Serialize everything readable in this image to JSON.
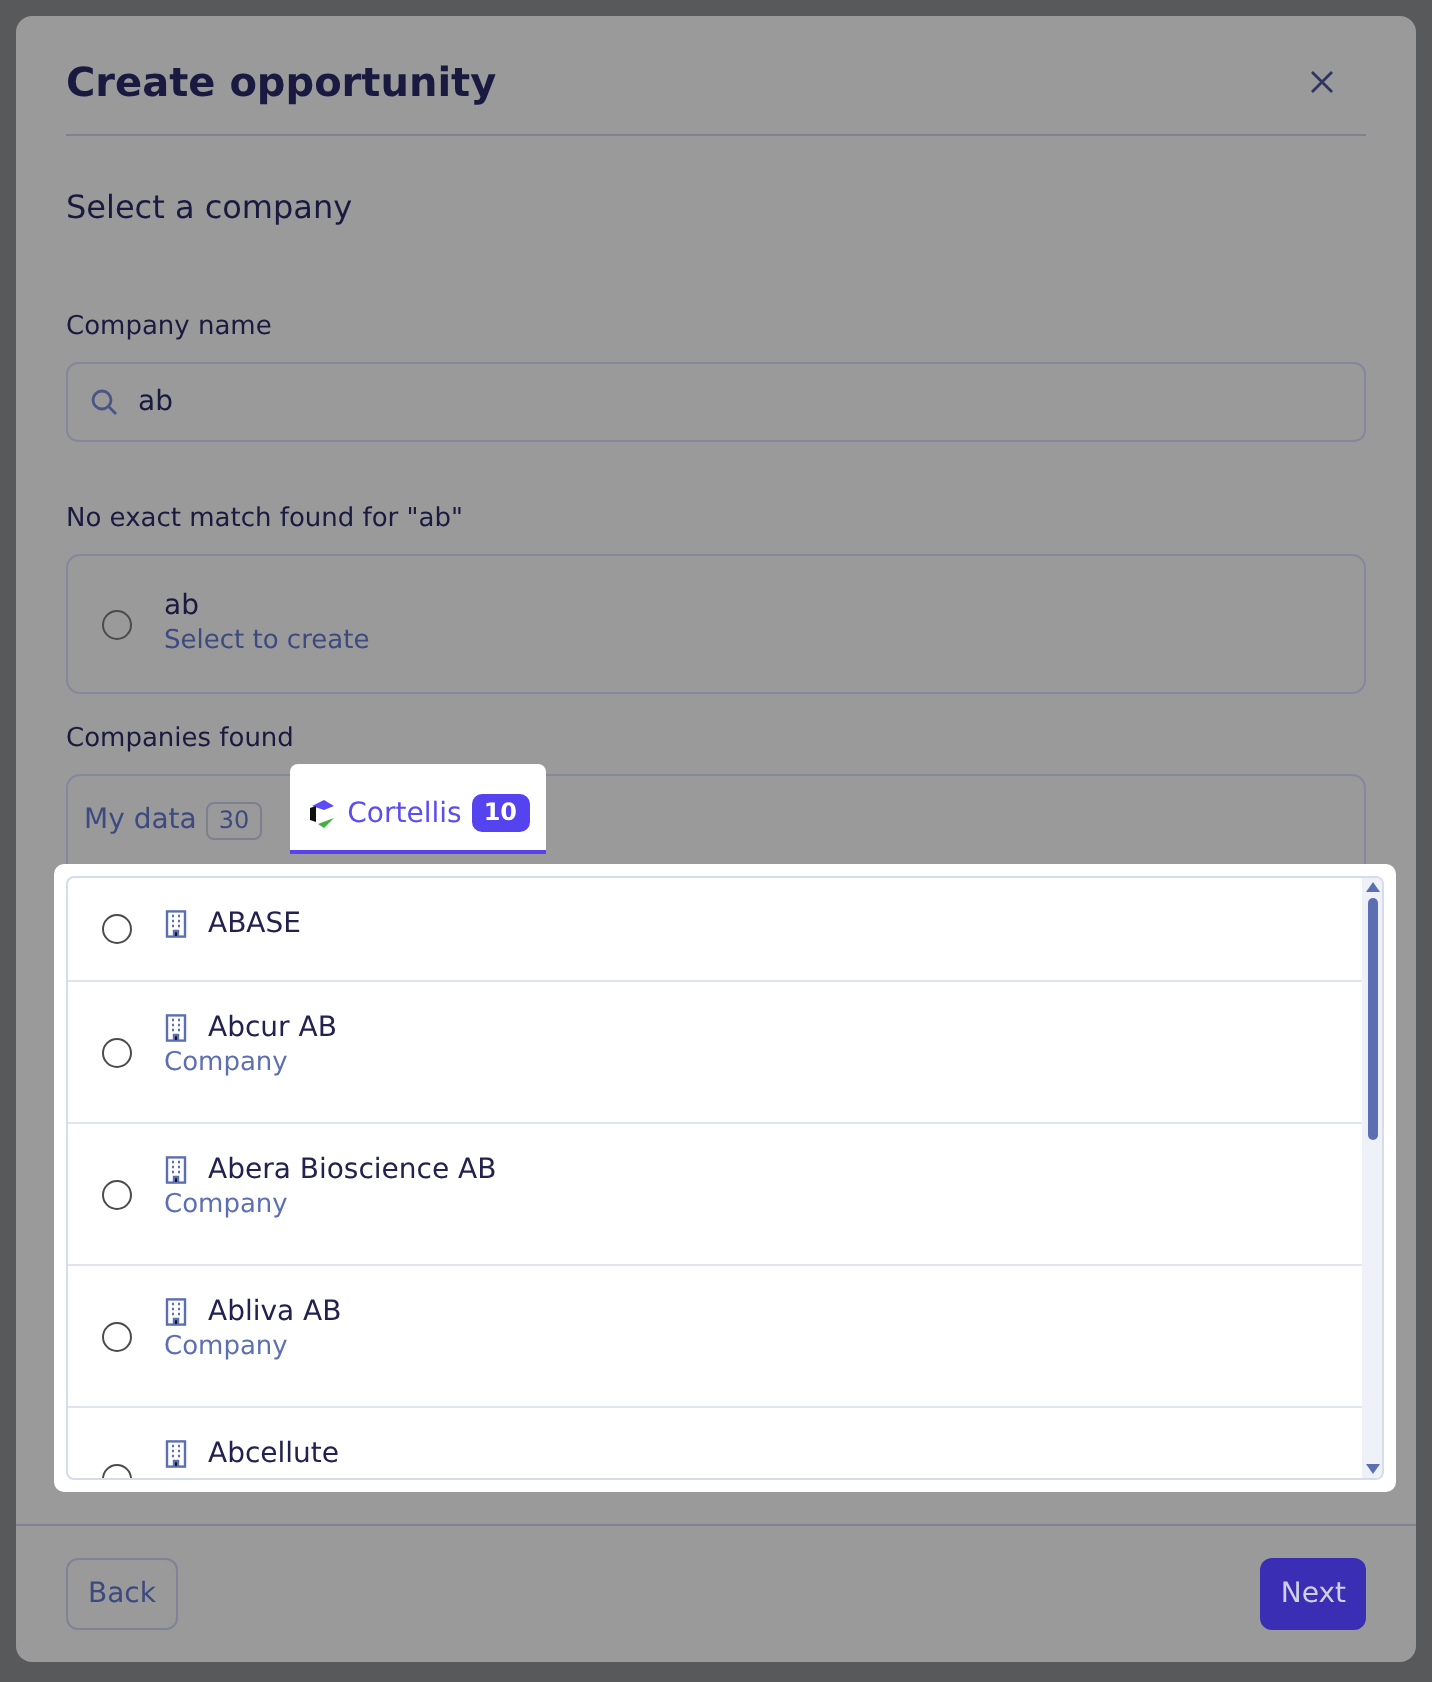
{
  "dialog": {
    "title": "Create opportunity",
    "step_title": "Select a company",
    "company_name": {
      "label": "Company name",
      "value": "ab"
    },
    "no_match": {
      "message": "No exact match found for \"ab\"",
      "option": {
        "title": "ab",
        "subtitle": "Select to create",
        "selected": false
      }
    },
    "companies_found": {
      "label": "Companies found",
      "tabs": [
        {
          "label": "My data",
          "count": "30",
          "selected": false,
          "kind": "plain"
        },
        {
          "label": "Cortellis",
          "count": "10",
          "selected": true,
          "kind": "logo"
        }
      ],
      "results": [
        {
          "name": "ABASE",
          "selected": false
        },
        {
          "name": "Abcur AB",
          "type": "Company",
          "selected": false
        },
        {
          "name": "Abera Bioscience AB",
          "type": "Company",
          "selected": false
        },
        {
          "name": "Abliva AB",
          "type": "Company",
          "selected": false
        },
        {
          "name": "Abcellute",
          "selected": false
        }
      ]
    },
    "buttons": [
      {
        "label": "Back",
        "kind": "secondary"
      },
      {
        "label": "Next",
        "kind": "primary"
      }
    ]
  }
}
